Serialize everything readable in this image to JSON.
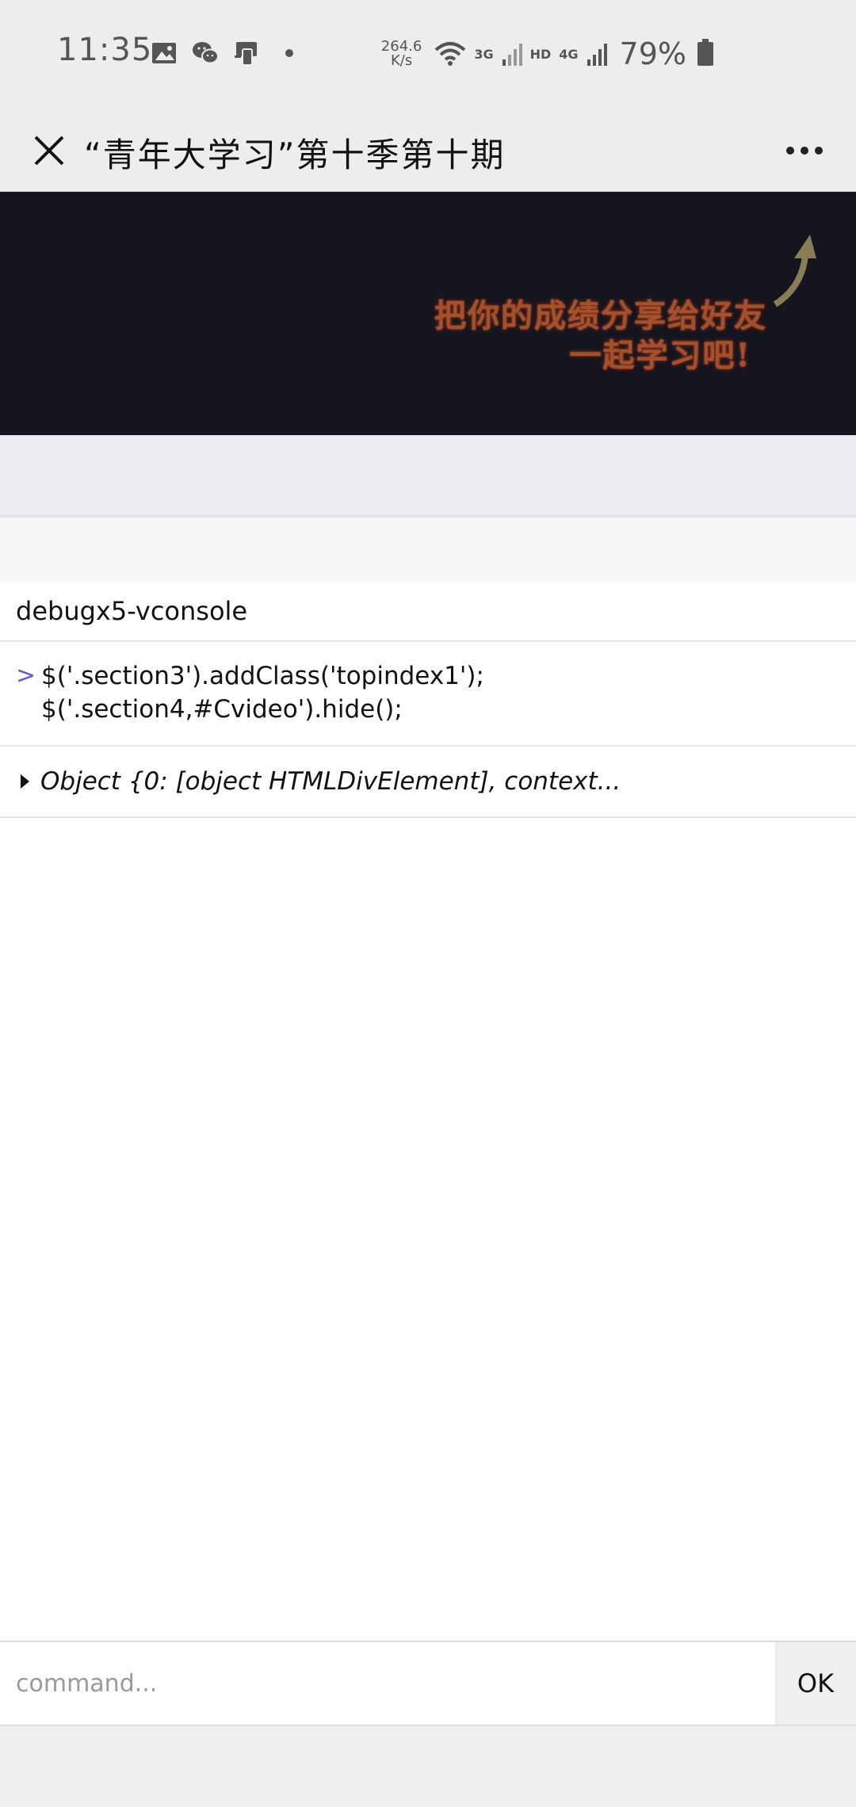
{
  "status_bar": {
    "time": "11:35",
    "net_speed_value": "264.6",
    "net_speed_unit": "K/s",
    "net_3g": "3G",
    "hd": "HD",
    "net_4g": "4G",
    "battery": "79%"
  },
  "title_bar": {
    "title": "“青年大学习”第十季第十期"
  },
  "banner": {
    "line1": "把你的成绩分享给好友",
    "line2": "一起学习吧!"
  },
  "console": {
    "header": "debugx5-vconsole",
    "prompt": ">",
    "input_lines": [
      "$('.section3').addClass('topindex1');",
      "$('.section4,#Cvideo').hide();"
    ],
    "output": "Object {0: [object HTMLDivElement], context..."
  },
  "command": {
    "placeholder": "command...",
    "ok_label": "OK"
  }
}
